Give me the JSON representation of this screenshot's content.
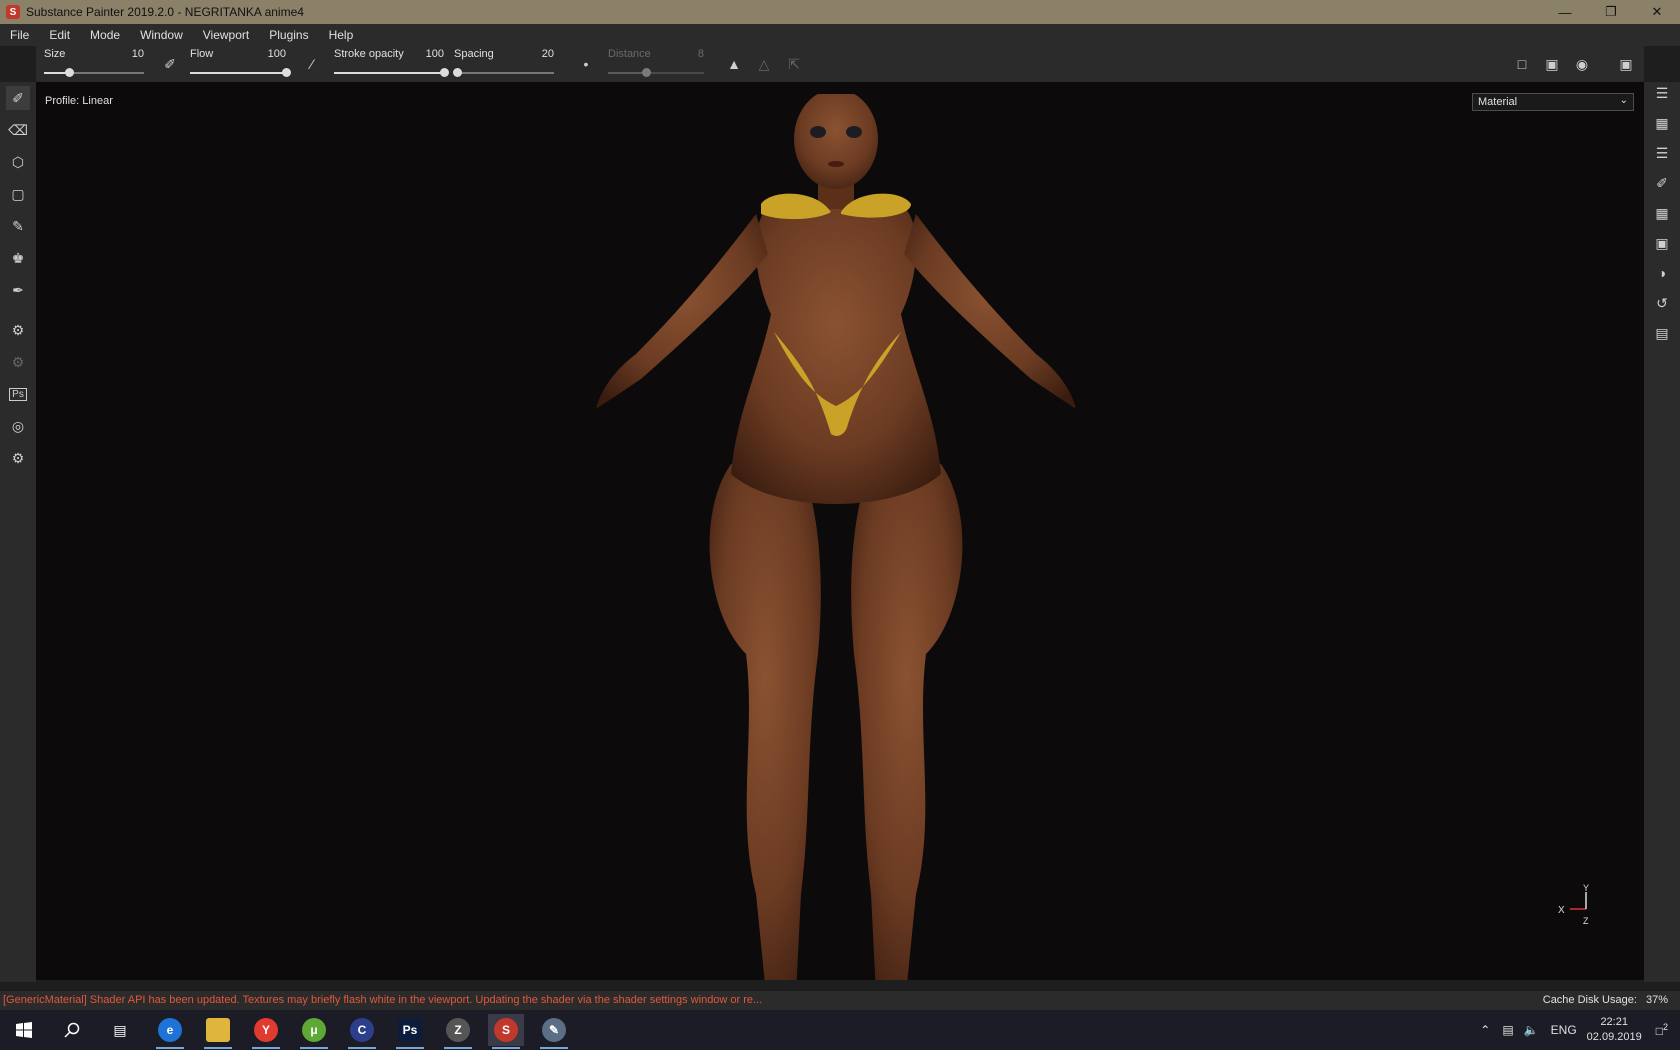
{
  "window": {
    "title": "Substance Painter 2019.2.0 - NEGRITANKA anime4",
    "app_icon_label": "S"
  },
  "menu": [
    "File",
    "Edit",
    "Mode",
    "Window",
    "Viewport",
    "Plugins",
    "Help"
  ],
  "toolbar": {
    "size": {
      "label": "Size",
      "value": "10",
      "fraction": 0.25
    },
    "flow": {
      "label": "Flow",
      "value": "100",
      "fraction": 1.0
    },
    "stroke_opacity": {
      "label": "Stroke opacity",
      "value": "100",
      "fraction": 1.0
    },
    "spacing": {
      "label": "Spacing",
      "value": "20",
      "fraction": 0.03
    },
    "distance": {
      "label": "Distance",
      "value": "8",
      "fraction": 0.4
    }
  },
  "viewport": {
    "profile_label": "Profile: Linear",
    "mode_select": "Material",
    "axis": {
      "x": "X",
      "y": "Y",
      "z": "Z"
    },
    "colors": {
      "skin": "#6b3b22",
      "skin_shadow": "#3a1d10",
      "bikini": "#c9a227",
      "background": "#0c0a0a"
    }
  },
  "status": {
    "message": "[GenericMaterial] Shader API has been updated. Textures may briefly flash white in the viewport. Updating the shader via the shader settings window or re...",
    "cache_label": "Cache Disk Usage:",
    "cache_value": "37%"
  },
  "taskbar": {
    "language": "ENG",
    "time": "22:21",
    "date": "02.09.2019",
    "notifications": "2",
    "apps": [
      {
        "name": "edge",
        "glyph": "e",
        "color": "#1e73d6"
      },
      {
        "name": "file-explorer",
        "glyph": "",
        "color": "#e0b53c"
      },
      {
        "name": "yandex-browser",
        "glyph": "Y",
        "color": "#e03b2e"
      },
      {
        "name": "utorrent",
        "glyph": "μ",
        "color": "#5ea935"
      },
      {
        "name": "cinema4d",
        "glyph": "C",
        "color": "#2c3f8c"
      },
      {
        "name": "photoshop",
        "glyph": "Ps",
        "color": "#0b1d3a"
      },
      {
        "name": "zbrush",
        "glyph": "Z",
        "color": "#555"
      },
      {
        "name": "substance-painter",
        "glyph": "S",
        "color": "#c0392b"
      },
      {
        "name": "paint-app",
        "glyph": "✎",
        "color": "#5b6e86"
      }
    ]
  }
}
